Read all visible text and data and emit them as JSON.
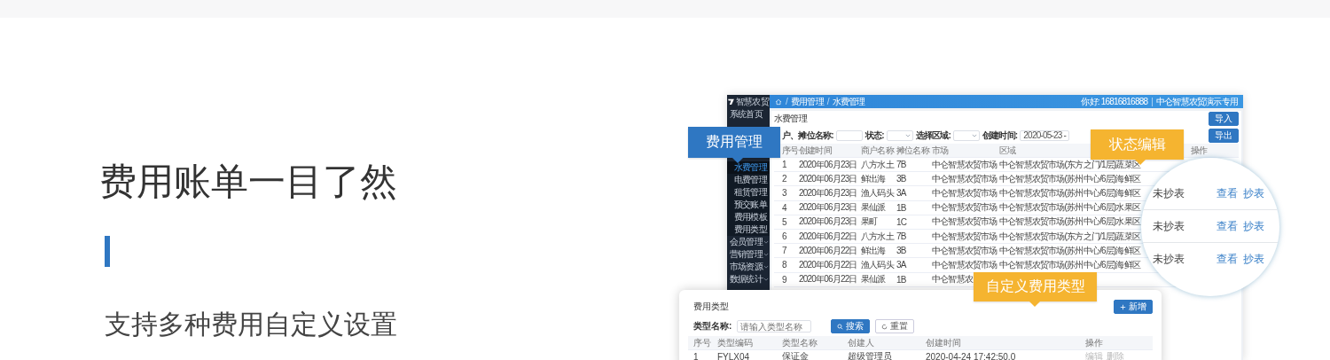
{
  "hero": {
    "title": "费用账单一目了然",
    "subtitle": "支持多种费用自定义设置"
  },
  "app": {
    "logo_text": "智慧农贸",
    "breadcrumb": [
      {
        "kind": "sep",
        "text": "/"
      },
      {
        "kind": "item",
        "text": "费用管理"
      },
      {
        "kind": "sep",
        "text": "/"
      },
      {
        "kind": "item",
        "text": "水费管理"
      }
    ],
    "header_right": [
      {
        "kind": "text",
        "text": "你好: 16816816888"
      },
      {
        "kind": "sep",
        "text": "|"
      },
      {
        "kind": "text",
        "text": "中仑智慧农贸演示专用"
      }
    ],
    "sidebar": {
      "top": [
        "系统首页"
      ],
      "submenu": [
        {
          "label": "水费管理",
          "selected": true
        },
        {
          "label": "电费管理",
          "selected": false
        },
        {
          "label": "租赁管理",
          "selected": false
        },
        {
          "label": "预交账单",
          "selected": false
        },
        {
          "label": "费用模板",
          "selected": false
        },
        {
          "label": "费用类型",
          "selected": false
        }
      ],
      "groups": [
        "会员管理",
        "营销管理",
        "市场资源",
        "数据统计"
      ]
    },
    "page_title": "水费管理",
    "import_button": "导入",
    "filters": [
      {
        "kind": "input",
        "label": "户、摊位名称:"
      },
      {
        "kind": "select",
        "label": "状态:"
      },
      {
        "kind": "select",
        "label": "选择区域:"
      },
      {
        "kind": "date",
        "label": "创建时间:",
        "value": "2020-05-23 -"
      }
    ],
    "export_button": "导出",
    "columns": [
      "序号",
      "创建时间",
      "商户名称",
      "摊位名称",
      "市场",
      "区域",
      "操作"
    ],
    "rows": [
      [
        "1",
        "2020年06月23日",
        "八方水土",
        "7B",
        "中仑智慧农贸市场",
        "中仑智慧农贸市场(东方之门/1层)蔬菜区"
      ],
      [
        "2",
        "2020年06月23日",
        "鲜出海",
        "3B",
        "中仑智慧农贸市场",
        "中仑智慧农贸市场(苏州中心/6层)海鲜区"
      ],
      [
        "3",
        "2020年06月23日",
        "渔人码头",
        "3A",
        "中仑智慧农贸市场",
        "中仑智慧农贸市场(苏州中心/6层)海鲜区"
      ],
      [
        "4",
        "2020年06月23日",
        "果仙派",
        "1B",
        "中仑智慧农贸市场",
        "中仑智慧农贸市场(苏州中心/6层)水果区"
      ],
      [
        "5",
        "2020年06月23日",
        "果町",
        "1C",
        "中仑智慧农贸市场",
        "中仑智慧农贸市场(苏州中心/6层)水果区"
      ],
      [
        "6",
        "2020年06月22日",
        "八方水土",
        "7B",
        "中仑智慧农贸市场",
        "中仑智慧农贸市场(东方之门/1层)蔬菜区"
      ],
      [
        "7",
        "2020年06月22日",
        "鲜出海",
        "3B",
        "中仑智慧农贸市场",
        "中仑智慧农贸市场(苏州中心/6层)海鲜区"
      ],
      [
        "8",
        "2020年06月22日",
        "渔人码头",
        "3A",
        "中仑智慧农贸市场",
        "中仑智慧农贸市场(苏州中心/6层)海鲜区"
      ],
      [
        "9",
        "2020年06月22日",
        "果仙派",
        "1B",
        "中仑智慧农"
      ]
    ]
  },
  "magnifier": {
    "rows": [
      {
        "status": "未抄表",
        "actions": [
          "查看",
          "抄表"
        ]
      },
      {
        "status": "未抄表",
        "actions": [
          "查看",
          "抄表"
        ]
      },
      {
        "status": "未抄表",
        "actions": [
          "查看",
          "抄表"
        ]
      }
    ]
  },
  "card": {
    "title": "费用类型",
    "filter_label": "类型名称:",
    "placeholder": "请输入类型名称",
    "search_button": "搜索",
    "reset_button": "重置",
    "add_button": "新增",
    "columns": [
      "序号",
      "类型编码",
      "类型名称",
      "创建人",
      "创建时间",
      "操作"
    ],
    "rows": [
      {
        "cells": [
          "1",
          "FYLX04",
          "保证金",
          "超级管理员",
          "2020-04-24 17:42:50.0"
        ],
        "actions": [
          "编辑",
          "删除"
        ]
      }
    ]
  },
  "callouts": [
    {
      "text": "费用管理",
      "color": "#2f77c2"
    },
    {
      "text": "状态编辑",
      "color": "#f5b430"
    },
    {
      "text": "自定义费用类型",
      "color": "#f5b430"
    }
  ]
}
